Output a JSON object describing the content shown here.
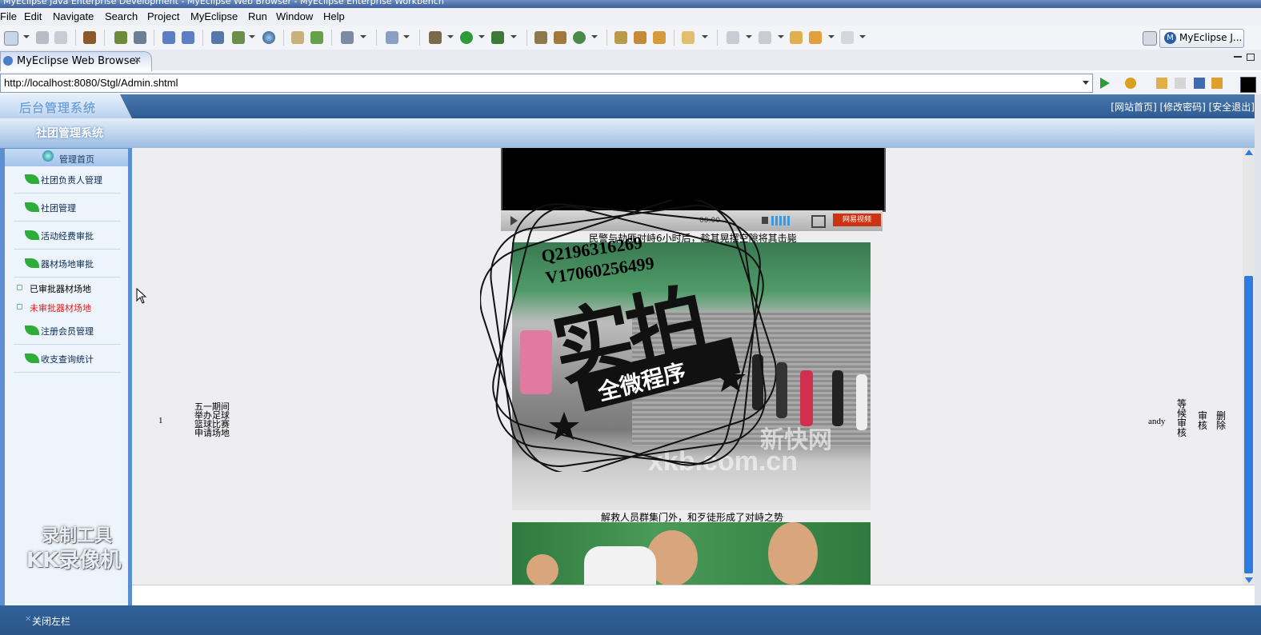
{
  "window": {
    "title": "MyEclipse Java Enterprise Development - MyEclipse Web Browser - MyEclipse Enterprise Workbench"
  },
  "menu": [
    "File",
    "Edit",
    "Navigate",
    "Search",
    "Project",
    "MyEclipse",
    "Run",
    "Window",
    "Help"
  ],
  "perspective": {
    "label": "MyEclipse J..."
  },
  "editor_tab": {
    "label": "MyEclipse Web Browser",
    "close": "✕"
  },
  "address": {
    "url": "http://localhost:8080/Stgl/Admin.shtml"
  },
  "web": {
    "system_title": "后台管理系统",
    "top_links": "[网站首页] [修改密码] [安全退出]",
    "subtitle": "社团管理系统",
    "home_link": "管理首页",
    "sidebar_items": [
      {
        "label": "社团负责人管理"
      },
      {
        "label": "社团管理"
      },
      {
        "label": "活动经费审批"
      },
      {
        "label": "器材场地审批"
      }
    ],
    "sub_items": [
      {
        "label": "已审批器材场地",
        "color": "#000000"
      },
      {
        "label": "未审批器材场地",
        "color": "#e02020"
      }
    ],
    "sidebar_items_2": [
      {
        "label": "注册会员管理"
      },
      {
        "label": "收支查询统计"
      }
    ],
    "row": {
      "index": "1",
      "title": "五一期间举办足球篮球比赛申请场地",
      "user": "andy",
      "status": "等候审核",
      "action_review": "审核",
      "action_delete": "删除"
    },
    "video": {
      "time": "00:00",
      "brand": "网易视频"
    },
    "caption1": "民警与劫匪对峙6小时后，趁其晃摆空隙将其击毙",
    "caption2": "解救人员群集门外，和歹徒形成了对峙之势",
    "photo_watermark": "xkb.com.cn",
    "photo_brand": "新快网",
    "close_sidebar": "关闭左栏"
  },
  "overlay": {
    "qq": "Q2196316269",
    "phone": "V17060256499",
    "big": "实拍",
    "banner": "全微程序",
    "recorder1": "录制工具",
    "recorder2": "KK录像机"
  },
  "colors": {
    "header_blue": "#2d5b92",
    "sidebar_blue": "#5b8fcf",
    "scroll_blue": "#2c7be0"
  }
}
